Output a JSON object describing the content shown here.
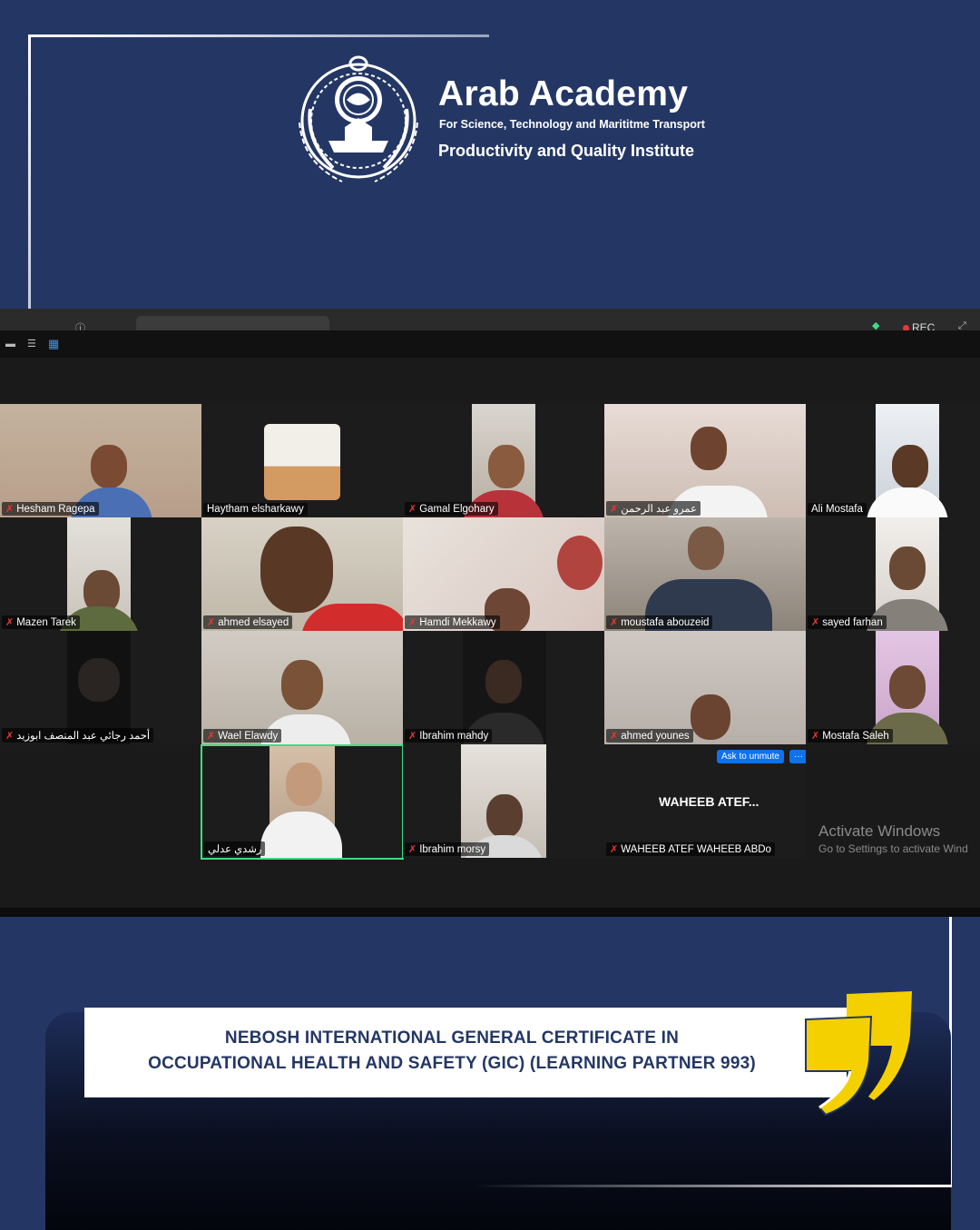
{
  "brand": {
    "title": "Arab Academy",
    "subtitle": "For Science, Technology and Marititme Transport",
    "institute": "Productivity and Quality Institute"
  },
  "zoom": {
    "rec_label": "REC",
    "participants": [
      {
        "name": "Hesham Ragepa",
        "muted": true
      },
      {
        "name": "Haytham elsharkawy",
        "muted": false
      },
      {
        "name": "Gamal Elgohary",
        "muted": true
      },
      {
        "name": "عمرو عبد الرحمن",
        "muted": true
      },
      {
        "name": "Ali Mostafa",
        "muted": false
      },
      {
        "name": "Mazen Tarek",
        "muted": true
      },
      {
        "name": "ahmed elsayed",
        "muted": true
      },
      {
        "name": "Hamdi Mekkawy",
        "muted": true
      },
      {
        "name": "moustafa abouzeid",
        "muted": true
      },
      {
        "name": "sayed farhan",
        "muted": true
      },
      {
        "name": "أحمد رجائي عبد المنصف ابوزيد",
        "muted": true
      },
      {
        "name": "Wael Elawdy",
        "muted": true
      },
      {
        "name": "Ibrahim mahdy",
        "muted": true
      },
      {
        "name": "ahmed younes",
        "muted": true
      },
      {
        "name": "Mostafa Saleh",
        "muted": true
      },
      {
        "name": "رشدي عدلي",
        "muted": false
      },
      {
        "name": "Ibrahim morsy",
        "muted": true
      },
      {
        "name": "WAHEEB ATEF WAHEEB ABDo",
        "muted": true
      }
    ],
    "big_name": "WAHEEB  ATEF...",
    "ask_unmute": "Ask to unmute",
    "more": "···",
    "activate_title": "Activate Windows",
    "activate_sub": "Go to Settings to activate Wind"
  },
  "caption": {
    "line1": "NEBOSH INTERNATIONAL GENERAL CERTIFICATE IN",
    "line2": "OCCUPATIONAL HEALTH AND SAFETY (GIC) (LEARNING PARTNER 993)"
  },
  "colors": {
    "background": "#243764",
    "accent_yellow": "#f5d000",
    "caption_text": "#243764"
  }
}
